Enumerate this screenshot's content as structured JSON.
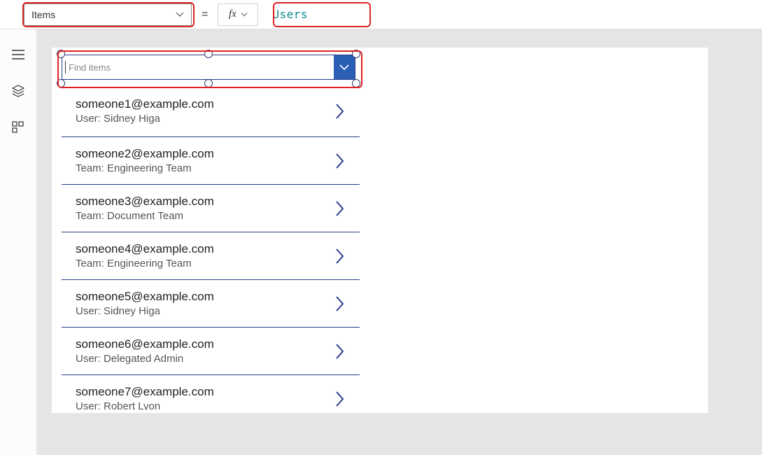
{
  "formula_bar": {
    "property_label": "Items",
    "fx_label": "fx",
    "equals": "=",
    "formula_text": "Users"
  },
  "combobox": {
    "placeholder": "Find items"
  },
  "items": [
    {
      "title": "someone1@example.com",
      "subtitle": "User: Sidney Higa"
    },
    {
      "title": "someone2@example.com",
      "subtitle": "Team: Engineering Team"
    },
    {
      "title": "someone3@example.com",
      "subtitle": "Team: Document Team"
    },
    {
      "title": "someone4@example.com",
      "subtitle": "Team: Engineering Team"
    },
    {
      "title": "someone5@example.com",
      "subtitle": "User: Sidney Higa"
    },
    {
      "title": "someone6@example.com",
      "subtitle": "User: Delegated Admin"
    },
    {
      "title": "someone7@example.com",
      "subtitle": "User: Robert Lyon"
    }
  ]
}
